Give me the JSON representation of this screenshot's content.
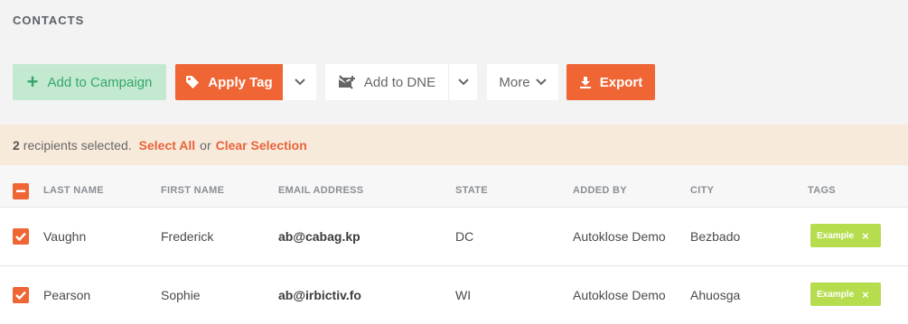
{
  "page_title": "CONTACTS",
  "toolbar": {
    "add_to_campaign": "Add to Campaign",
    "apply_tag": "Apply Tag",
    "add_to_dne": "Add to DNE",
    "more": "More",
    "export": "Export"
  },
  "selection": {
    "count": "2",
    "text": "recipients selected.",
    "select_all": "Select All",
    "or": "or",
    "clear_selection": "Clear Selection"
  },
  "table": {
    "headers": {
      "last_name": "LAST NAME",
      "first_name": "FIRST NAME",
      "email": "EMAIL ADDRESS",
      "state": "STATE",
      "added_by": "ADDED BY",
      "city": "CITY",
      "tags": "TAGS"
    },
    "rows": [
      {
        "last_name": "Vaughn",
        "first_name": "Frederick",
        "email": "ab@cabag.kp",
        "state": "DC",
        "added_by": "Autoklose Demo",
        "city": "Bezbado",
        "tag": "Example",
        "tag_remove": "×"
      },
      {
        "last_name": "Pearson",
        "first_name": "Sophie",
        "email": "ab@irbictiv.fo",
        "state": "WI",
        "added_by": "Autoklose Demo",
        "city": "Ahuosga",
        "tag": "Example",
        "tag_remove": "×"
      }
    ]
  },
  "colors": {
    "accent": "#ef6534",
    "campaign_bg": "#c3ead0",
    "campaign_text": "#35a56b",
    "selection_bg": "#f8eadb",
    "tag_bg": "#b5dd4e"
  }
}
